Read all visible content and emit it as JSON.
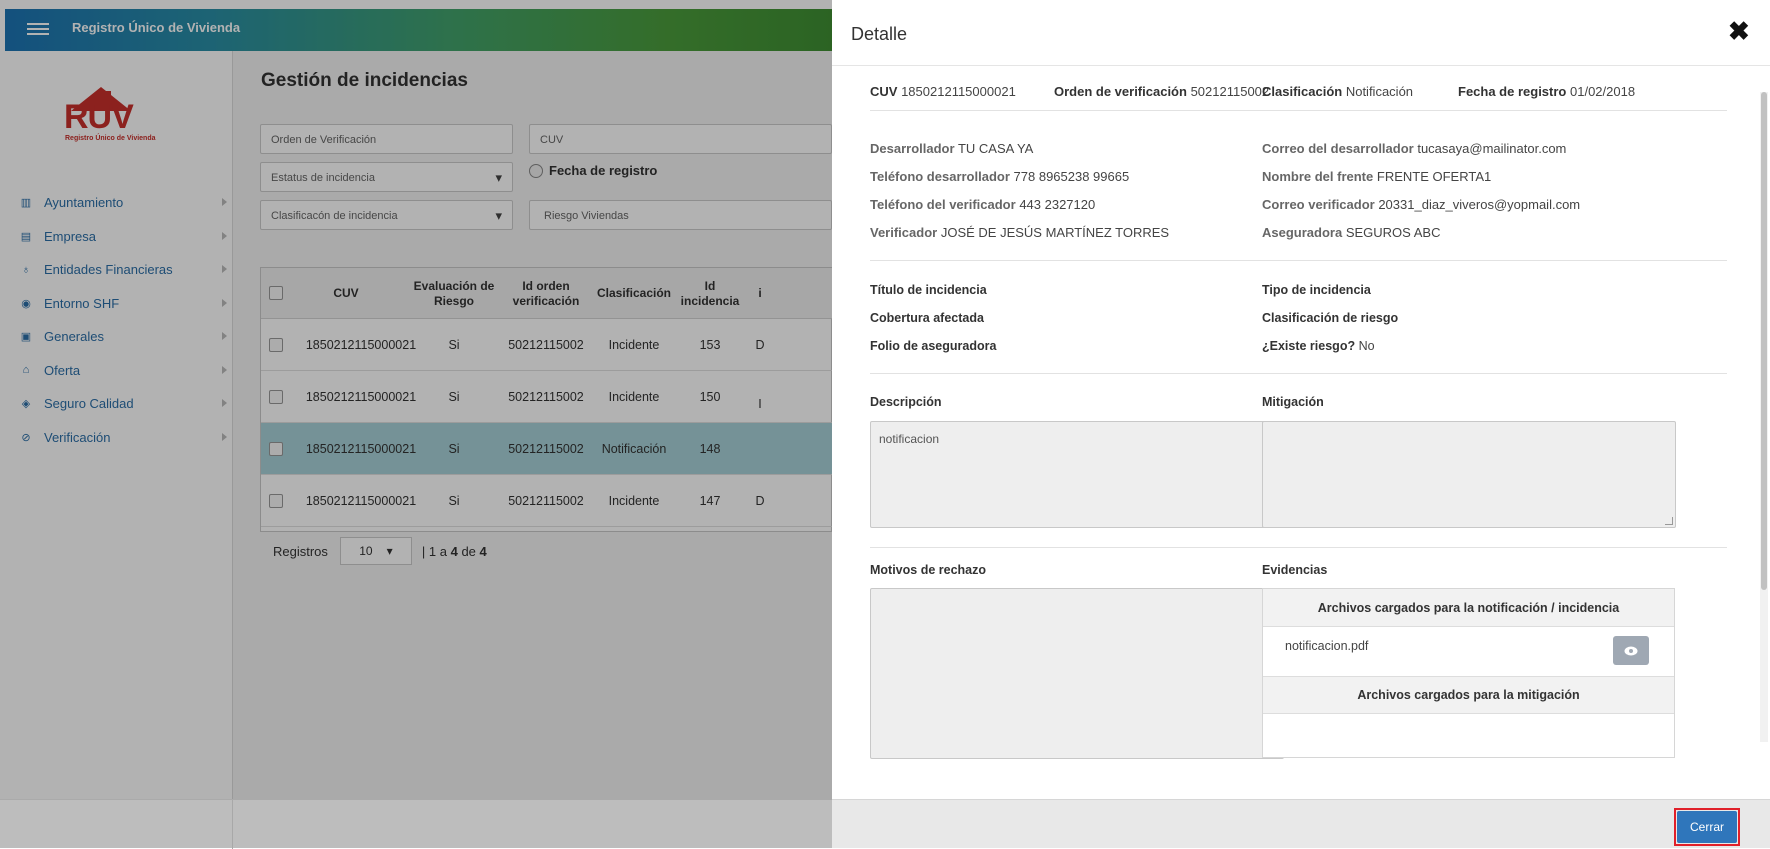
{
  "app": {
    "title": "Registro Único de Vivienda"
  },
  "logo": {
    "text_r": "RUV",
    "sub": "Registro Único de Vivienda"
  },
  "sidebar": {
    "items": [
      {
        "label": "Ayuntamiento",
        "icon": "map-icon"
      },
      {
        "label": "Empresa",
        "icon": "building-icon"
      },
      {
        "label": "Entidades Financieras",
        "icon": "people-icon"
      },
      {
        "label": "Entorno SHF",
        "icon": "target-icon"
      },
      {
        "label": "Generales",
        "icon": "document-icon"
      },
      {
        "label": "Oferta",
        "icon": "home-icon"
      },
      {
        "label": "Seguro Calidad",
        "icon": "shield-icon"
      },
      {
        "label": "Verificación",
        "icon": "check-circle-icon"
      }
    ]
  },
  "main": {
    "title": "Gestión de incidencias",
    "filters": {
      "orden_placeholder": "Orden de Verificación",
      "cuv_placeholder": "CUV",
      "estatus": "Estatus de incidencia",
      "fecha_registro": "Fecha de registro",
      "clasificacion": "Clasificacón de incidencia",
      "riesgo": "Riesgo Viviendas"
    },
    "table": {
      "headers": [
        "CUV",
        "Evaluación de Riesgo",
        "Id orden verificación",
        "Clasificación",
        "Id incidencia",
        "i"
      ],
      "rows": [
        {
          "cuv": "1850212115000021",
          "riesgo": "Si",
          "orden": "50212115002",
          "clasificacion": "Incidente",
          "id": "153",
          "extra": "D"
        },
        {
          "cuv": "1850212115000021",
          "riesgo": "Si",
          "orden": "50212115002",
          "clasificacion": "Incidente",
          "id": "150",
          "extra": "I"
        },
        {
          "cuv": "1850212115000021",
          "riesgo": "Si",
          "orden": "50212115002",
          "clasificacion": "Notificación",
          "id": "148",
          "extra": ""
        },
        {
          "cuv": "1850212115000021",
          "riesgo": "Si",
          "orden": "50212115002",
          "clasificacion": "Incidente",
          "id": "147",
          "extra": "D"
        }
      ]
    },
    "pager": {
      "label": "Registros",
      "page_size": "10",
      "range_prefix": "| 1 a ",
      "range_to": "4",
      "range_de": " de ",
      "total": "4"
    }
  },
  "modal": {
    "title": "Detalle",
    "summary": {
      "cuv_label": "CUV",
      "cuv": "1850212115000021",
      "orden_label": "Orden de verificación",
      "orden": "50212115002",
      "clasif_label": "Clasificación",
      "clasif": "Notificación",
      "fecha_label": "Fecha de registro",
      "fecha": "01/02/2018"
    },
    "info": {
      "desarrollador_label": "Desarrollador",
      "desarrollador": "TU CASA YA",
      "correo_des_label": "Correo del desarrollador",
      "correo_des": "tucasaya@mailinator.com",
      "tel_des_label": "Teléfono desarrollador",
      "tel_des": "778 8965238 99665",
      "frente_label": "Nombre del frente",
      "frente": "FRENTE OFERTA1",
      "tel_ver_label": "Teléfono del verificador",
      "tel_ver": "443 2327120",
      "correo_ver_label": "Correo verificador",
      "correo_ver": "20331_diaz_viveros@yopmail.com",
      "verificador_label": "Verificador",
      "verificador": "JOSÉ DE JESÚS MARTÍNEZ TORRES",
      "aseguradora_label": "Aseguradora",
      "aseguradora": "SEGUROS ABC"
    },
    "incidencia": {
      "titulo_label": "Título de incidencia",
      "tipo_label": "Tipo de incidencia",
      "cobertura_label": "Cobertura afectada",
      "clasif_riesgo_label": "Clasificación de riesgo",
      "folio_label": "Folio de aseguradora",
      "existe_riesgo_label": "¿Existe riesgo?",
      "existe_riesgo": "No"
    },
    "descripcion_label": "Descripción",
    "descripcion": "notificacion",
    "mitigacion_label": "Mitigación",
    "motivos_label": "Motivos de rechazo",
    "evidencias_label": "Evidencias",
    "evidencias": {
      "notif_header": "Archivos cargados para la notificación / incidencia",
      "file": "notificacion.pdf",
      "mitig_header": "Archivos cargados para la mitigación"
    },
    "cerrar": "Cerrar"
  },
  "colors": {
    "accent": "#2f76bb",
    "highlight": "#e0202a",
    "selected_row": "#a8d2d8"
  }
}
